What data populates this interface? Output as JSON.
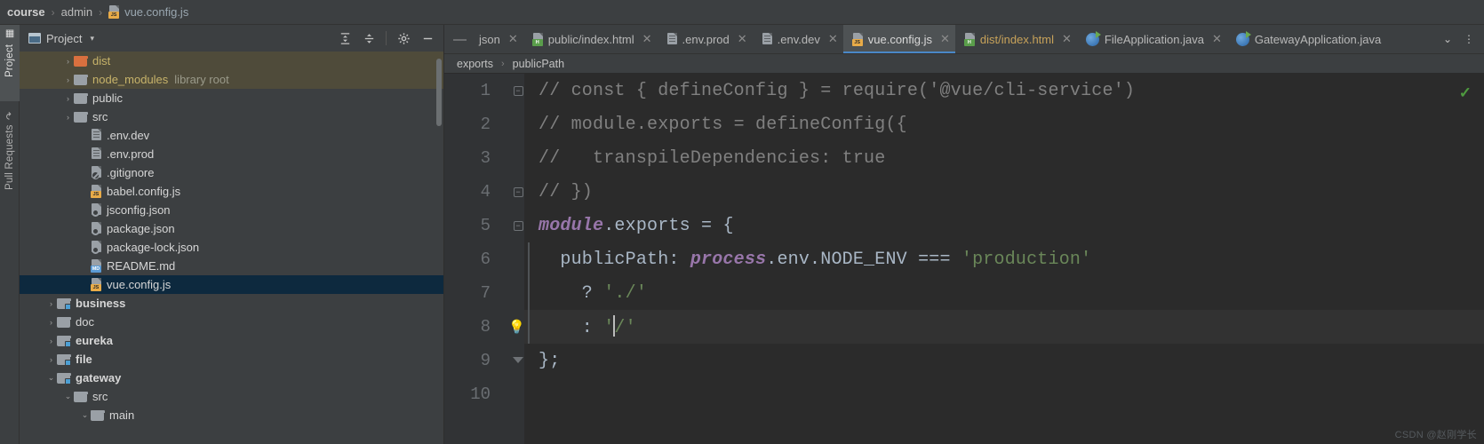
{
  "window": {
    "breadcrumb": [
      {
        "label": "course",
        "icon": null,
        "style": "bold"
      },
      {
        "label": "admin",
        "icon": null,
        "style": "normal"
      },
      {
        "label": "vue.config.js",
        "icon": "js-file-icon",
        "style": "link"
      }
    ],
    "separator": "›"
  },
  "tool_stripe": {
    "tabs": [
      {
        "label": "Project",
        "icon": "project-window-icon",
        "active": true
      },
      {
        "label": "Pull Requests",
        "icon": "pull-request-icon",
        "active": false
      }
    ]
  },
  "project_panel": {
    "title": "Project",
    "dropdown_caret": "▾",
    "toolbar": [
      {
        "name": "expand-all-button",
        "glyph": "⨁"
      },
      {
        "name": "collapse-all-button",
        "glyph": "⨂"
      },
      {
        "name": "settings-gear-button",
        "glyph": "⚙"
      },
      {
        "name": "hide-panel-button",
        "glyph": "−"
      }
    ],
    "tree": [
      {
        "label": "dist",
        "indent": 2,
        "arrow": "›",
        "icon": "folder-orange",
        "text_style": "dist",
        "highlight": "library",
        "hint": ""
      },
      {
        "label": "node_modules",
        "indent": 2,
        "arrow": "›",
        "icon": "folder",
        "text_style": "nodemod",
        "highlight": "library",
        "hint": "library root"
      },
      {
        "label": "public",
        "indent": 2,
        "arrow": "›",
        "icon": "folder",
        "text_style": "",
        "highlight": "",
        "hint": ""
      },
      {
        "label": "src",
        "indent": 2,
        "arrow": "›",
        "icon": "folder",
        "text_style": "",
        "highlight": "",
        "hint": ""
      },
      {
        "label": ".env.dev",
        "indent": 3,
        "arrow": "",
        "icon": "file-plain",
        "text_style": "",
        "highlight": "",
        "hint": ""
      },
      {
        "label": ".env.prod",
        "indent": 3,
        "arrow": "",
        "icon": "file-plain",
        "text_style": "",
        "highlight": "",
        "hint": ""
      },
      {
        "label": ".gitignore",
        "indent": 3,
        "arrow": "",
        "icon": "file-gitignore",
        "text_style": "",
        "highlight": "",
        "hint": ""
      },
      {
        "label": "babel.config.js",
        "indent": 3,
        "arrow": "",
        "icon": "file-js",
        "text_style": "",
        "highlight": "",
        "hint": ""
      },
      {
        "label": "jsconfig.json",
        "indent": 3,
        "arrow": "",
        "icon": "file-json",
        "text_style": "",
        "highlight": "",
        "hint": ""
      },
      {
        "label": "package.json",
        "indent": 3,
        "arrow": "",
        "icon": "file-json",
        "text_style": "",
        "highlight": "",
        "hint": ""
      },
      {
        "label": "package-lock.json",
        "indent": 3,
        "arrow": "",
        "icon": "file-json",
        "text_style": "",
        "highlight": "",
        "hint": ""
      },
      {
        "label": "README.md",
        "indent": 3,
        "arrow": "",
        "icon": "file-md",
        "text_style": "",
        "highlight": "",
        "hint": ""
      },
      {
        "label": "vue.config.js",
        "indent": 3,
        "arrow": "",
        "icon": "file-js",
        "text_style": "",
        "highlight": "selected",
        "hint": ""
      },
      {
        "label": "business",
        "indent": 1,
        "arrow": "›",
        "icon": "folder-module",
        "text_style": "bold",
        "highlight": "",
        "hint": ""
      },
      {
        "label": "doc",
        "indent": 1,
        "arrow": "›",
        "icon": "folder",
        "text_style": "",
        "highlight": "",
        "hint": ""
      },
      {
        "label": "eureka",
        "indent": 1,
        "arrow": "›",
        "icon": "folder-module",
        "text_style": "bold",
        "highlight": "",
        "hint": ""
      },
      {
        "label": "file",
        "indent": 1,
        "arrow": "›",
        "icon": "folder-module",
        "text_style": "bold",
        "highlight": "",
        "hint": ""
      },
      {
        "label": "gateway",
        "indent": 1,
        "arrow": "⌄",
        "icon": "folder-module",
        "text_style": "bold",
        "highlight": "",
        "hint": ""
      },
      {
        "label": "src",
        "indent": 2,
        "arrow": "⌄",
        "icon": "folder",
        "text_style": "",
        "highlight": "",
        "hint": ""
      },
      {
        "label": "main",
        "indent": 3,
        "arrow": "⌄",
        "icon": "folder",
        "text_style": "",
        "highlight": "",
        "hint": ""
      }
    ]
  },
  "editor_tabs": {
    "leading_dash": "—",
    "tabs": [
      {
        "label": "json",
        "icon": "",
        "active": false,
        "clipped": true,
        "close": "✕"
      },
      {
        "label": "public/index.html",
        "icon": "file-html",
        "active": false,
        "close": "✕"
      },
      {
        "label": ".env.prod",
        "icon": "file-plain",
        "active": false,
        "close": "✕"
      },
      {
        "label": ".env.dev",
        "icon": "file-plain",
        "active": false,
        "close": "✕"
      },
      {
        "label": "vue.config.js",
        "icon": "file-js",
        "active": true,
        "close": "✕"
      },
      {
        "label": "dist/index.html",
        "icon": "file-html",
        "active": false,
        "orange": true,
        "close": "✕"
      },
      {
        "label": "FileApplication.java",
        "icon": "java-class-icon",
        "active": false,
        "close": "✕"
      },
      {
        "label": "GatewayApplication.java",
        "icon": "java-class-icon",
        "active": false,
        "close": ""
      }
    ],
    "right_controls": [
      {
        "name": "tab-list-dropdown-button",
        "glyph": "⌄"
      },
      {
        "name": "editor-options-menu-button",
        "glyph": "⋮"
      }
    ]
  },
  "editor_breadcrumb": {
    "separator": "›",
    "items": [
      "exports",
      "publicPath"
    ]
  },
  "code": {
    "inspection_status_icon": "✓",
    "lines": [
      {
        "num": "1",
        "gutter": "fold-open",
        "tokens": [
          {
            "t": "// const { defineConfig } = require('@vue/cli-service')",
            "c": "cmt"
          }
        ]
      },
      {
        "num": "2",
        "gutter": "",
        "tokens": [
          {
            "t": "// module.exports = defineConfig({",
            "c": "cmt"
          }
        ]
      },
      {
        "num": "3",
        "gutter": "",
        "tokens": [
          {
            "t": "//   transpileDependencies: true",
            "c": "cmt"
          }
        ]
      },
      {
        "num": "4",
        "gutter": "fold-close",
        "tokens": [
          {
            "t": "// })",
            "c": "cmt"
          }
        ]
      },
      {
        "num": "5",
        "gutter": "fold-open",
        "tokens": [
          {
            "t": "module",
            "c": "glb"
          },
          {
            "t": ".exports = {",
            "c": "op"
          }
        ]
      },
      {
        "num": "6",
        "gutter": "",
        "tokens": [
          {
            "t": "  publicPath: ",
            "c": "prop"
          },
          {
            "t": "process",
            "c": "glb"
          },
          {
            "t": ".env.NODE_ENV === ",
            "c": "op"
          },
          {
            "t": "'production'",
            "c": "str"
          }
        ]
      },
      {
        "num": "7",
        "gutter": "",
        "tokens": [
          {
            "t": "    ? ",
            "c": "op"
          },
          {
            "t": "'./'",
            "c": "str"
          }
        ]
      },
      {
        "num": "8",
        "gutter": "bulb",
        "highlight": true,
        "caret_after": 2,
        "tokens": [
          {
            "t": "    : ",
            "c": "op"
          },
          {
            "t": "'",
            "c": "str"
          },
          {
            "t": "/'",
            "c": "str"
          }
        ]
      },
      {
        "num": "9",
        "gutter": "fold-end",
        "tokens": [
          {
            "t": "};",
            "c": "op"
          }
        ]
      },
      {
        "num": "10",
        "gutter": "",
        "tokens": []
      }
    ],
    "bulb_glyph": "💡"
  },
  "watermark": "CSDN @赵刚学长",
  "colors": {
    "panel_bg": "#3c3f41",
    "editor_bg": "#2b2b2b",
    "gutter_bg": "#313335",
    "selection_blue": "#0d293e",
    "library_highlight": "#4f4b3a",
    "accent_tab_underline": "#4a88c7",
    "comment": "#808080",
    "string": "#6a8759",
    "global_var": "#9876aa",
    "default_text": "#a9b7c6",
    "status_ok": "#4e9a3f"
  }
}
